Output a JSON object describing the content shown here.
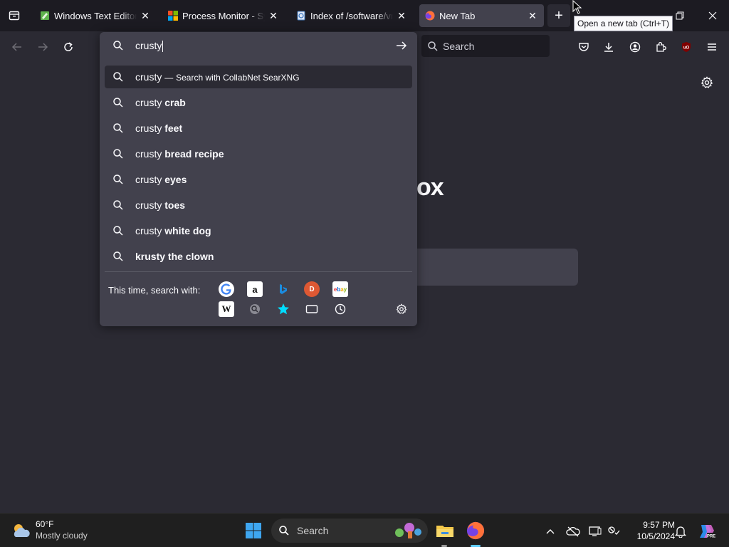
{
  "tabs": [
    {
      "title": "Windows Text Editor Fa",
      "icon": "notepad-icon"
    },
    {
      "title": "Process Monitor - Sysin",
      "icon": "microsoft-icon"
    },
    {
      "title": "Index of /software/vme",
      "icon": "page-icon"
    },
    {
      "title": "New Tab",
      "icon": "firefox-icon"
    }
  ],
  "tooltip": "Open a new tab (Ctrl+T)",
  "navbar": {
    "search_placeholder": "Search"
  },
  "urlbar": {
    "value": "crusty",
    "heuristic": {
      "query": "crusty",
      "separator": "—",
      "engine_text": "Search with CollabNet SearXNG"
    },
    "suggestions": [
      {
        "prefix": "crusty ",
        "bold": "crab"
      },
      {
        "prefix": "crusty ",
        "bold": "feet"
      },
      {
        "prefix": "crusty ",
        "bold": "bread recipe"
      },
      {
        "prefix": "crusty ",
        "bold": "eyes"
      },
      {
        "prefix": "crusty ",
        "bold": "toes"
      },
      {
        "prefix": "crusty ",
        "bold": "white dog"
      },
      {
        "prefix": "",
        "bold": "krusty the clown"
      }
    ],
    "one_off_label": "This time, search with:",
    "engines": [
      "google",
      "amazon",
      "bing",
      "duckduckgo",
      "ebay",
      "wikipedia",
      "searxng",
      "bookmarks",
      "tabs",
      "history"
    ]
  },
  "page": {
    "logo_partial": "ox"
  },
  "taskbar": {
    "weather_temp": "60°F",
    "weather_desc": "Mostly cloudy",
    "search_placeholder": "Search",
    "time": "9:57 PM",
    "date": "10/5/2024"
  },
  "colors": {
    "accent": "#00ddff",
    "panel": "#42414d",
    "toolbar": "#2b2a33",
    "tabstrip": "#1c1b22"
  }
}
